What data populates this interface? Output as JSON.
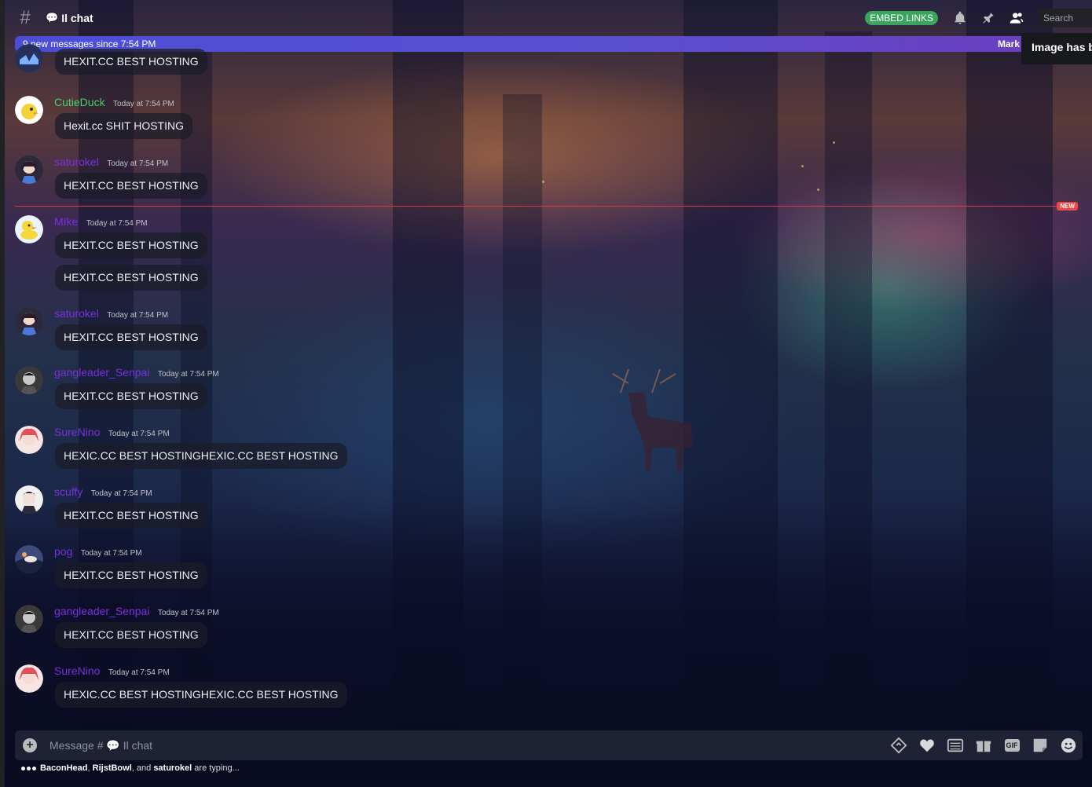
{
  "header": {
    "channel_icon": "hash-icon",
    "channel_emoji": "💬",
    "channel_name": "Il chat",
    "embed_links": "EMBED LINKS",
    "search_placeholder": "Search",
    "icons": [
      "bell-icon",
      "pin-icon",
      "member-list-icon"
    ]
  },
  "new_messages_bar": {
    "text": "9 new messages since 7:54 PM",
    "mark_label": "Mark"
  },
  "tooltip": "Image has b",
  "new_divider_label": "NEW",
  "messages": [
    {
      "username": "",
      "timestamp": "",
      "color": "#7289da",
      "text": [
        "HEXIT.CC BEST HOSTING"
      ]
    },
    {
      "username": "CutieDuck",
      "timestamp": "Today at 7:54 PM",
      "color": "#43d16e",
      "text": [
        "Hexit.cc SHIT HOSTING"
      ]
    },
    {
      "username": "saturokel",
      "timestamp": "Today at 7:54 PM",
      "color": "#7b2fe0",
      "text": [
        "HEXIT.CC BEST HOSTING"
      ]
    },
    {
      "username": "MIke",
      "timestamp": "Today at 7:54 PM",
      "color": "#7b2fe0",
      "text": [
        "HEXIT.CC BEST HOSTING",
        "HEXIT.CC BEST HOSTING"
      ]
    },
    {
      "username": "saturokel",
      "timestamp": "Today at 7:54 PM",
      "color": "#7b2fe0",
      "text": [
        "HEXIT.CC BEST HOSTING"
      ]
    },
    {
      "username": "gangleader_Senpai",
      "timestamp": "Today at 7:54 PM",
      "color": "#7b2fe0",
      "text": [
        "HEXIT.CC BEST HOSTING"
      ]
    },
    {
      "username": "SureNino",
      "timestamp": "Today at 7:54 PM",
      "color": "#7b2fe0",
      "text": [
        "HEXIC.CC BEST HOSTINGHEXIC.CC BEST HOSTING"
      ]
    },
    {
      "username": "scuffy",
      "timestamp": "Today at 7:54 PM",
      "color": "#7b2fe0",
      "text": [
        "HEXIT.CC BEST HOSTING"
      ]
    },
    {
      "username": "pog",
      "timestamp": "Today at 7:54 PM",
      "color": "#7b2fe0",
      "text": [
        "HEXIT.CC BEST HOSTING"
      ]
    },
    {
      "username": "gangleader_Senpai",
      "timestamp": "Today at 7:54 PM",
      "color": "#7b2fe0",
      "text": [
        "HEXIT.CC BEST HOSTING"
      ]
    },
    {
      "username": "SureNino",
      "timestamp": "Today at 7:54 PM",
      "color": "#7b2fe0",
      "text": [
        "HEXIC.CC BEST HOSTINGHEXIC.CC BEST HOSTING"
      ]
    }
  ],
  "composer": {
    "placeholder_prefix": "Message #",
    "placeholder_emoji": "💬",
    "placeholder_channel": "Il chat",
    "gif_label": "GIF",
    "tools": [
      "code-icon",
      "heart-icon",
      "list-icon",
      "gift-icon",
      "gif-icon",
      "sticker-icon",
      "emoji-icon"
    ]
  },
  "typing": {
    "user1": "BaconHead",
    "sep1": ", ",
    "user2": "RijstBowl",
    "sep2": ", and ",
    "user3": "saturokel",
    "suffix": " are typing..."
  }
}
